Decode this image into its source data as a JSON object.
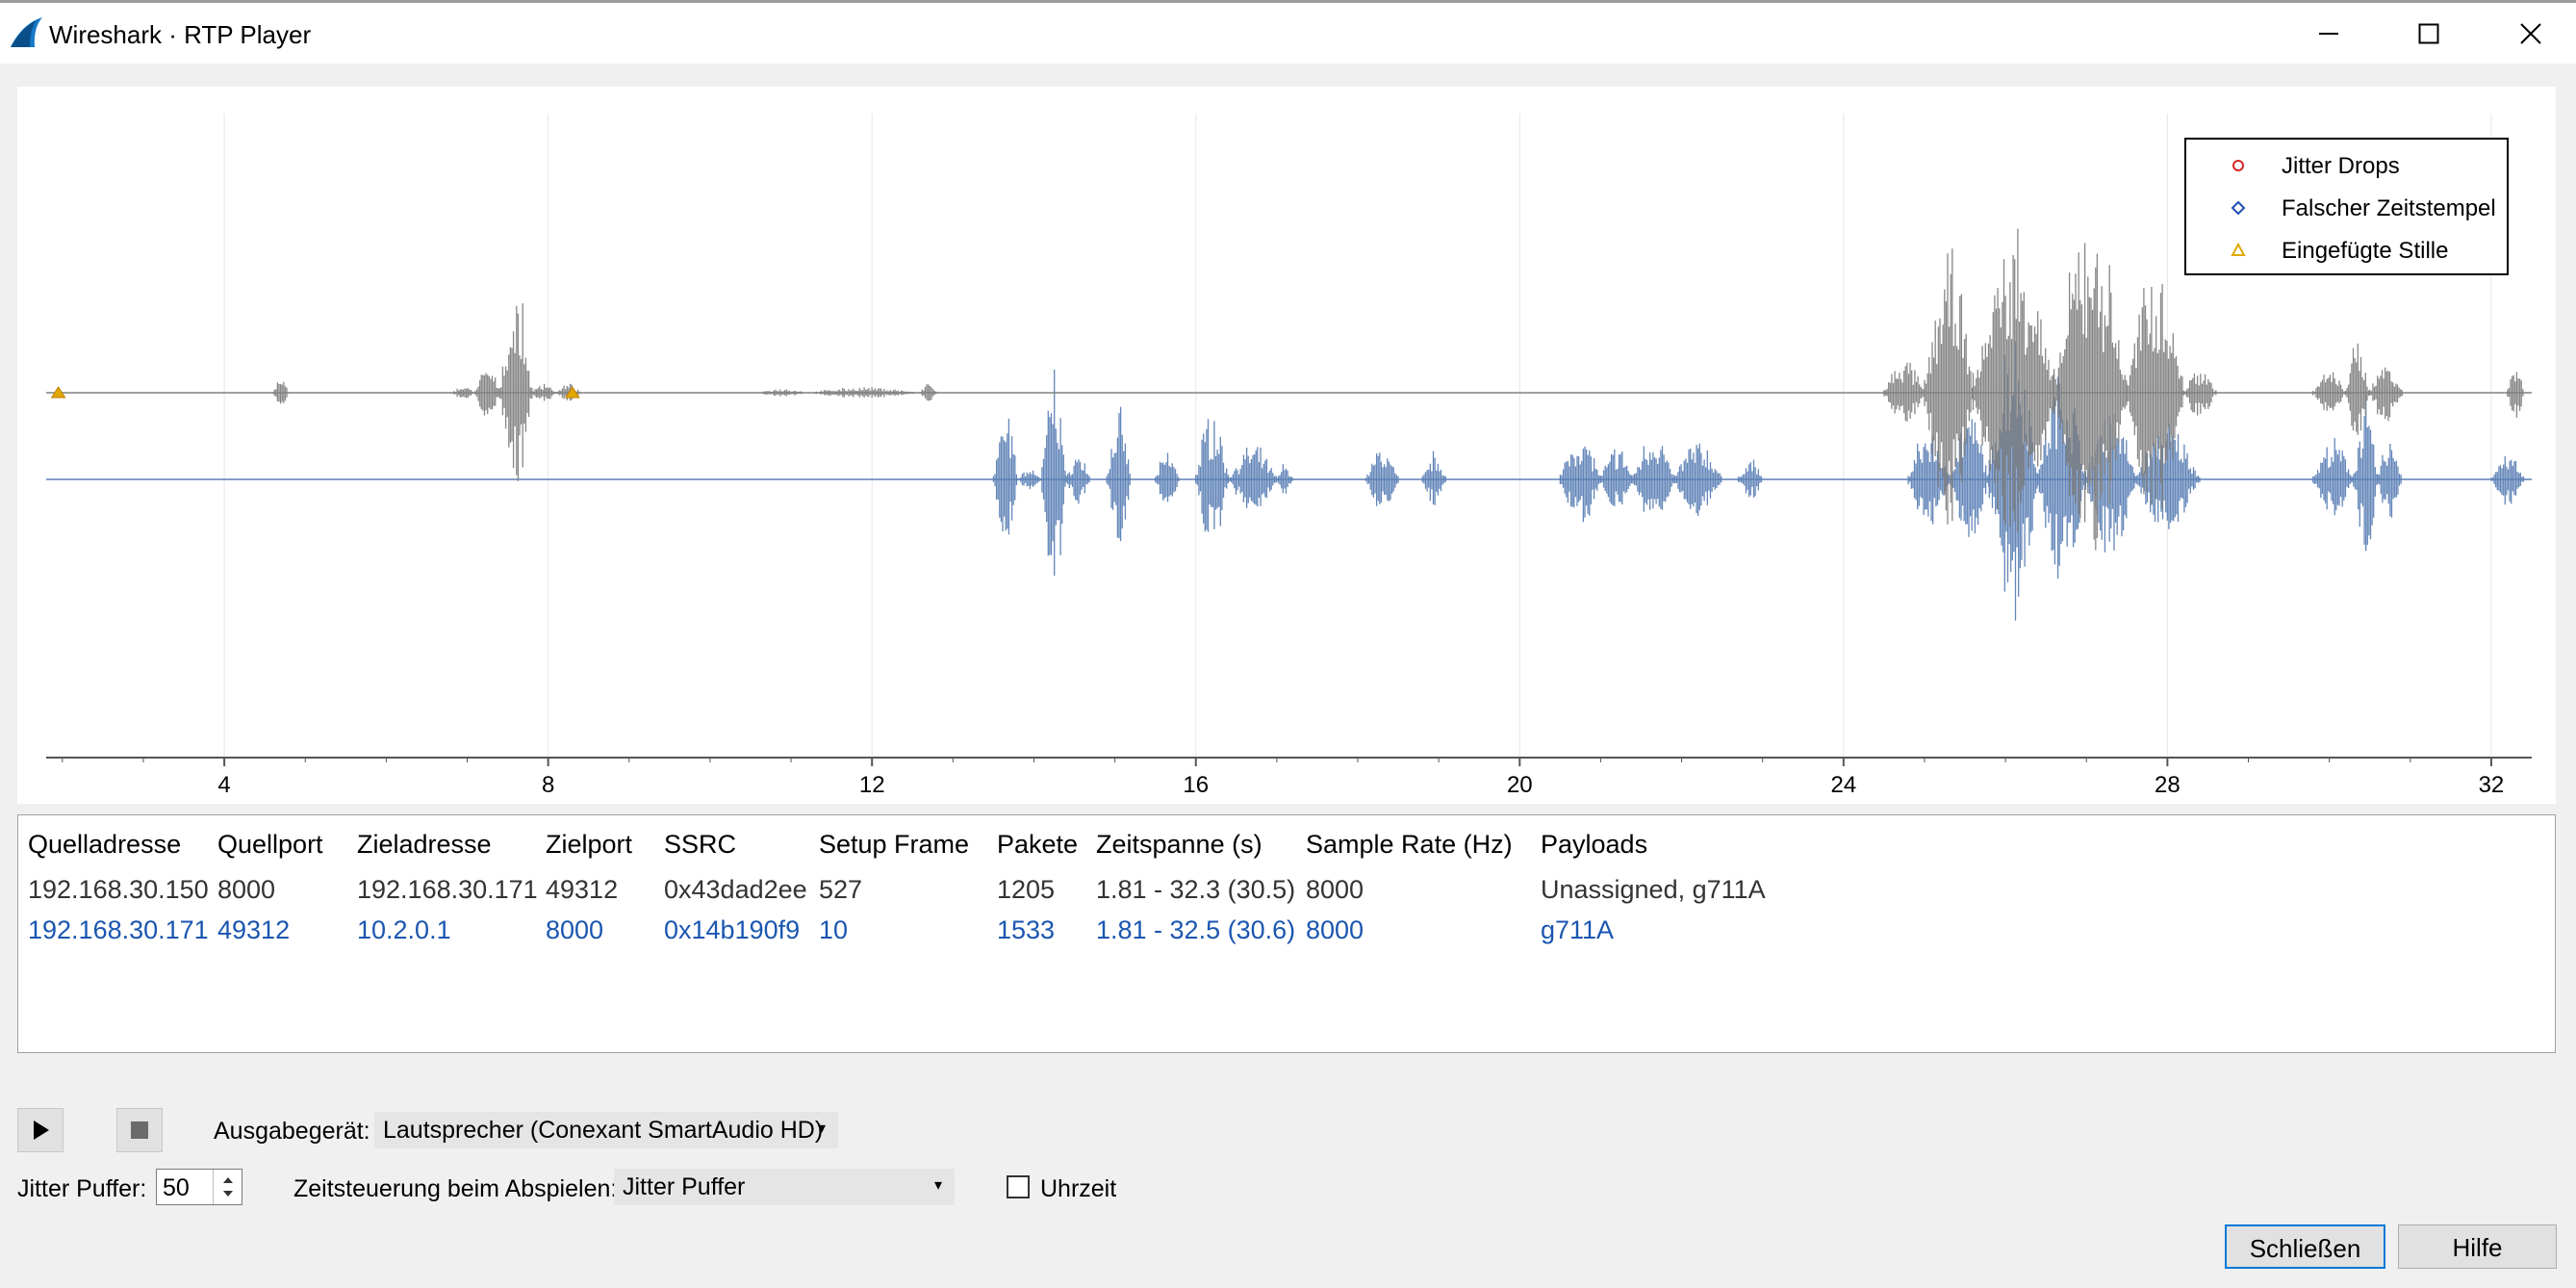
{
  "window": {
    "title": "Wireshark · RTP Player",
    "controls": {
      "minimize": "minimize-icon",
      "maximize": "maximize-icon",
      "close": "close-icon"
    }
  },
  "legend": {
    "items": [
      {
        "label": "Jitter Drops",
        "symbol": "circle",
        "color": "#d62728"
      },
      {
        "label": "Falscher Zeitstempel",
        "symbol": "diamond",
        "color": "#1f4fb0"
      },
      {
        "label": "Eingefügte Stille",
        "symbol": "triangle",
        "color": "#e0a800"
      }
    ]
  },
  "chart_data": {
    "type": "area",
    "xlim": [
      1.8,
      32.5
    ],
    "x_ticks": [
      "4",
      "8",
      "12",
      "16",
      "20",
      "24",
      "28",
      "32"
    ],
    "grid": "vertical",
    "series": [
      {
        "color": "#808080",
        "bursts": [
          {
            "start": 4.6,
            "end": 4.8,
            "amp": 0.12
          },
          {
            "start": 6.8,
            "end": 7.1,
            "amp": 0.06
          },
          {
            "start": 7.1,
            "end": 7.4,
            "amp": 0.25
          },
          {
            "start": 7.4,
            "end": 7.8,
            "amp": 0.9
          },
          {
            "start": 7.8,
            "end": 8.1,
            "amp": 0.1
          },
          {
            "start": 8.1,
            "end": 8.4,
            "amp": 0.08
          },
          {
            "start": 10.6,
            "end": 11.2,
            "amp": 0.04
          },
          {
            "start": 11.2,
            "end": 12.6,
            "amp": 0.05
          },
          {
            "start": 12.6,
            "end": 12.8,
            "amp": 0.1
          },
          {
            "start": 24.5,
            "end": 25.0,
            "amp": 0.3
          },
          {
            "start": 25.0,
            "end": 25.6,
            "amp": 1.25
          },
          {
            "start": 25.6,
            "end": 26.6,
            "amp": 1.45
          },
          {
            "start": 26.6,
            "end": 27.5,
            "amp": 1.6
          },
          {
            "start": 27.5,
            "end": 28.2,
            "amp": 1.2
          },
          {
            "start": 28.2,
            "end": 28.6,
            "amp": 0.25
          },
          {
            "start": 29.8,
            "end": 30.2,
            "amp": 0.2
          },
          {
            "start": 30.2,
            "end": 30.5,
            "amp": 0.45
          },
          {
            "start": 30.5,
            "end": 30.9,
            "amp": 0.3
          },
          {
            "start": 32.2,
            "end": 32.4,
            "amp": 0.3
          }
        ],
        "markers": [
          {
            "x": 1.95,
            "symbol": "triangle"
          },
          {
            "x": 8.3,
            "symbol": "triangle"
          }
        ]
      },
      {
        "color": "#5b7fb5",
        "bursts": [
          {
            "start": 13.5,
            "end": 13.8,
            "amp": 0.6
          },
          {
            "start": 13.8,
            "end": 14.1,
            "amp": 0.1
          },
          {
            "start": 14.1,
            "end": 14.4,
            "amp": 1.05
          },
          {
            "start": 14.4,
            "end": 14.7,
            "amp": 0.25
          },
          {
            "start": 14.9,
            "end": 15.2,
            "amp": 0.6
          },
          {
            "start": 15.5,
            "end": 15.8,
            "amp": 0.25
          },
          {
            "start": 16.0,
            "end": 16.4,
            "amp": 0.65
          },
          {
            "start": 16.4,
            "end": 17.0,
            "amp": 0.3
          },
          {
            "start": 17.0,
            "end": 17.2,
            "amp": 0.15
          },
          {
            "start": 18.1,
            "end": 18.5,
            "amp": 0.3
          },
          {
            "start": 18.8,
            "end": 19.1,
            "amp": 0.25
          },
          {
            "start": 20.5,
            "end": 21.0,
            "amp": 0.45
          },
          {
            "start": 21.0,
            "end": 21.4,
            "amp": 0.3
          },
          {
            "start": 21.4,
            "end": 21.9,
            "amp": 0.45
          },
          {
            "start": 21.9,
            "end": 22.5,
            "amp": 0.35
          },
          {
            "start": 22.7,
            "end": 23.0,
            "amp": 0.2
          },
          {
            "start": 24.8,
            "end": 25.3,
            "amp": 0.45
          },
          {
            "start": 25.3,
            "end": 25.8,
            "amp": 0.6
          },
          {
            "start": 25.8,
            "end": 26.4,
            "amp": 1.45
          },
          {
            "start": 26.4,
            "end": 27.0,
            "amp": 1.0
          },
          {
            "start": 27.0,
            "end": 27.6,
            "amp": 0.75
          },
          {
            "start": 27.6,
            "end": 28.4,
            "amp": 0.5
          },
          {
            "start": 29.8,
            "end": 30.3,
            "amp": 0.35
          },
          {
            "start": 30.3,
            "end": 30.6,
            "amp": 0.7
          },
          {
            "start": 30.6,
            "end": 30.9,
            "amp": 0.4
          },
          {
            "start": 32.0,
            "end": 32.4,
            "amp": 0.25
          }
        ],
        "markers": []
      }
    ]
  },
  "streams": {
    "columns": [
      "Quelladresse",
      "Quellport",
      "Zieladresse",
      "Zielport",
      "SSRC",
      "Setup Frame",
      "Pakete",
      "Zeitspanne (s)",
      "Sample Rate (Hz)",
      "Payloads"
    ],
    "rows": [
      [
        "192.168.30.150",
        "8000",
        "192.168.30.171",
        "49312",
        "0x43dad2ee",
        "527",
        "1205",
        "1.81 - 32.3 (30.5)",
        "8000",
        "Unassigned, g711A"
      ],
      [
        "192.168.30.171",
        "49312",
        "10.2.0.1",
        "8000",
        "0x14b190f9",
        "10",
        "1533",
        "1.81 - 32.5 (30.6)",
        "8000",
        "g711A"
      ]
    ],
    "selected_row_color": "#1a56b0"
  },
  "controls": {
    "output_label": "Ausgabegerät:",
    "output_device": "Lautsprecher (Conexant SmartAudio HD)",
    "jitter_label": "Jitter Puffer:",
    "jitter_value": "50",
    "timing_label": "Zeitsteuerung beim Abspielen:",
    "timing_value": "Jitter Puffer",
    "clock_label": "Uhrzeit",
    "clock_checked": false,
    "close_button": "Schließen",
    "help_button": "Hilfe"
  }
}
